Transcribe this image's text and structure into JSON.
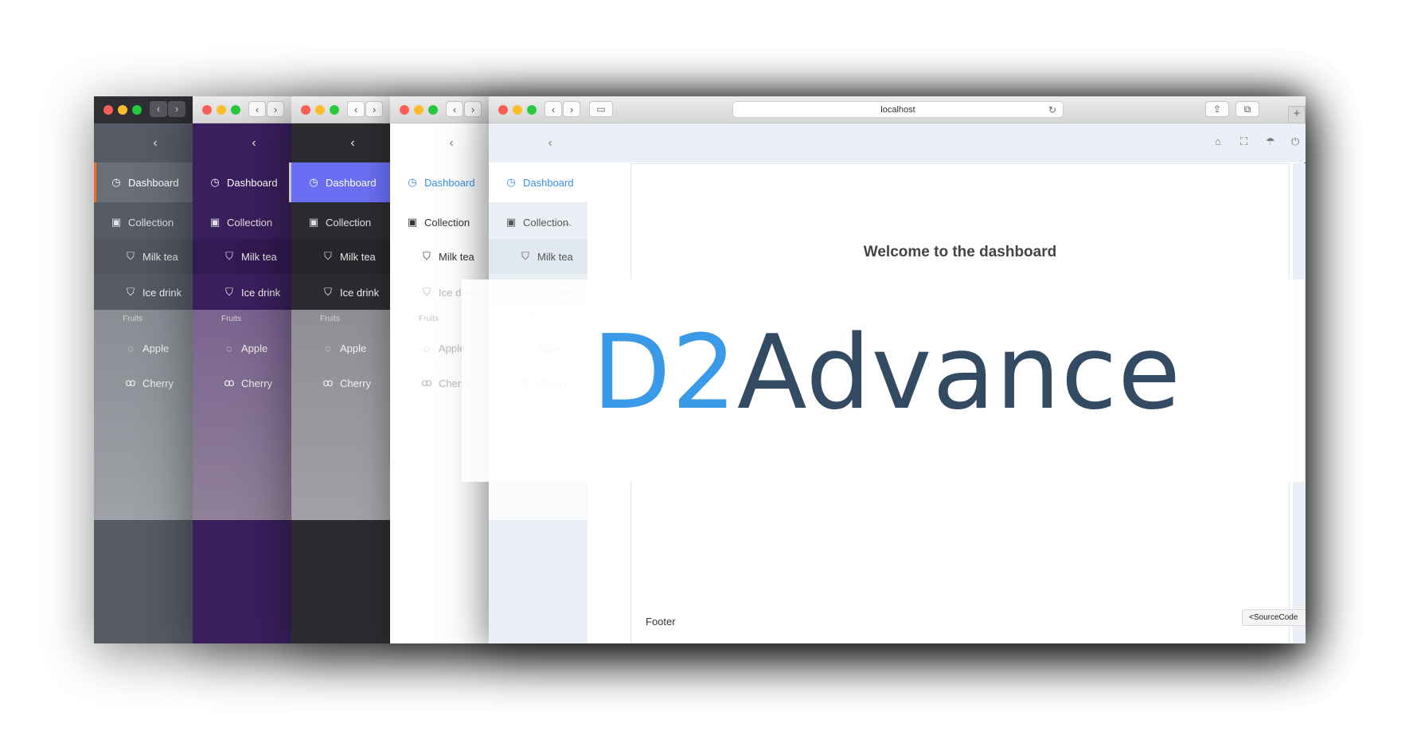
{
  "menu": {
    "dashboard": "Dashboard",
    "collection": "Collection",
    "milk_tea": "Milk tea",
    "ice_drink": "Ice drink",
    "fruits_group": "Fruits",
    "apple": "Apple",
    "cherry": "Cherry"
  },
  "browser": {
    "url": "localhost"
  },
  "page": {
    "welcome": "Welcome to the dashboard",
    "footer": "Footer",
    "source_button": "<SourceCode"
  },
  "logo": {
    "part1": "D2",
    "part2": "Advance"
  },
  "colors": {
    "accent_blue": "#3a9ae8",
    "logo_dark": "#334a63",
    "active_orange": "#f26b2a",
    "active_indigo": "#6a6ef2"
  }
}
